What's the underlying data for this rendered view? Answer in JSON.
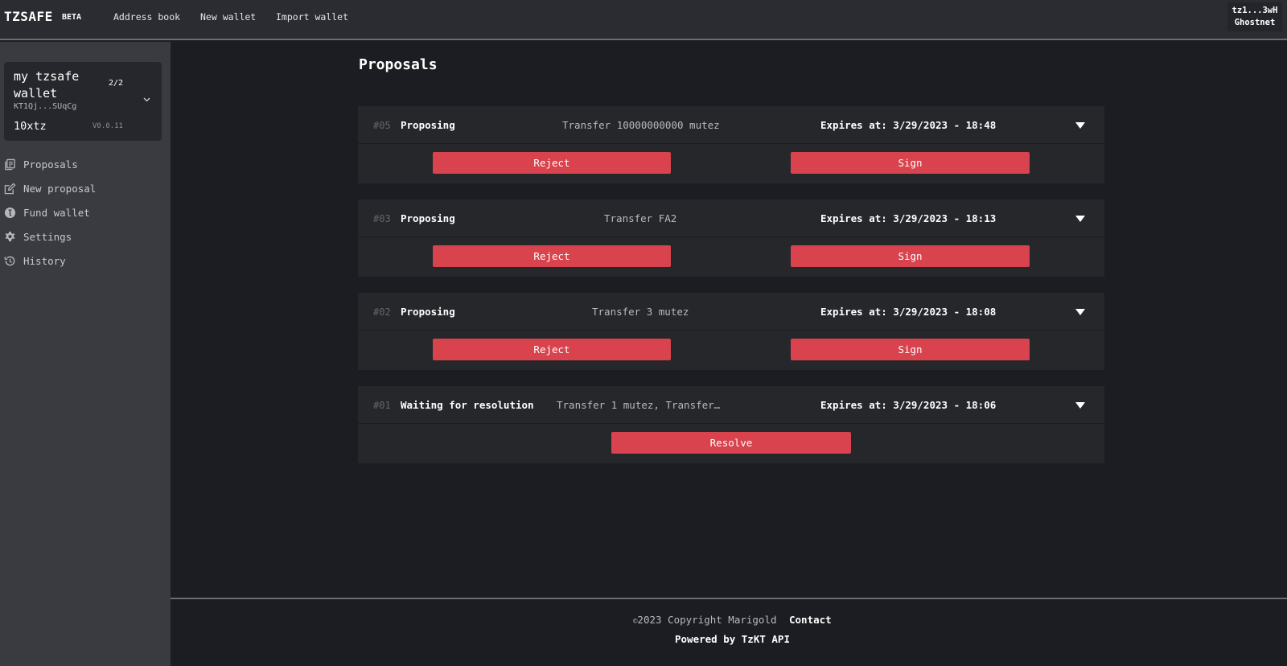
{
  "header": {
    "brand": "TZSAFE",
    "badge": "BETA",
    "nav": [
      "Address book",
      "New wallet",
      "Import wallet"
    ],
    "account": {
      "address": "tz1...3wH",
      "network": "Ghostnet"
    }
  },
  "sidebar": {
    "wallet": {
      "name": "my tzsafe wallet",
      "threshold": "2/2",
      "address": "KT1Qj...SUqCg",
      "balance": "10xtz",
      "version": "V0.0.11"
    },
    "items": [
      {
        "label": "Proposals",
        "icon": "proposals-icon"
      },
      {
        "label": "New proposal",
        "icon": "edit-icon"
      },
      {
        "label": "Fund wallet",
        "icon": "tezos-coin-icon"
      },
      {
        "label": "Settings",
        "icon": "gear-icon"
      },
      {
        "label": "History",
        "icon": "history-icon"
      }
    ]
  },
  "main": {
    "title": "Proposals",
    "proposals": [
      {
        "id": "#05",
        "status": "Proposing",
        "description": "Transfer 10000000000 mutez",
        "expires": "Expires at: 3/29/2023 - 18:48",
        "actions": [
          "Reject",
          "Sign"
        ]
      },
      {
        "id": "#03",
        "status": "Proposing",
        "description": "Transfer FA2",
        "expires": "Expires at: 3/29/2023 - 18:13",
        "actions": [
          "Reject",
          "Sign"
        ]
      },
      {
        "id": "#02",
        "status": "Proposing",
        "description": "Transfer 3 mutez",
        "expires": "Expires at: 3/29/2023 - 18:08",
        "actions": [
          "Reject",
          "Sign"
        ]
      },
      {
        "id": "#01",
        "status": "Waiting for resolution",
        "description": "Transfer 1 mutez, Transfer…",
        "expires": "Expires at: 3/29/2023 - 18:06",
        "actions": [
          "Resolve"
        ]
      }
    ]
  },
  "footer": {
    "copyright_symbol": "©",
    "copyright": "2023 Copyright Marigold",
    "contact": "Contact",
    "powered": "Powered by TzKT API"
  },
  "colors": {
    "accent": "#d8434d",
    "background": "#1c1d22",
    "sidebar": "#3a3b41",
    "card": "#26272b"
  }
}
